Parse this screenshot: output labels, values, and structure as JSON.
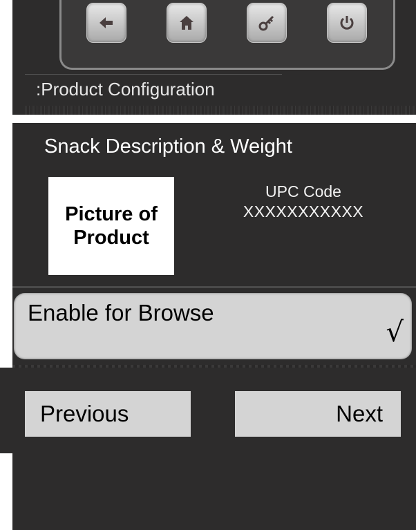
{
  "nav": {
    "back_icon": "back-arrow-icon",
    "home_icon": "home-icon",
    "key_icon": "key-icon",
    "power_icon": "power-icon"
  },
  "section": {
    "title": ":Product Configuration"
  },
  "product": {
    "heading": "Snack Description & Weight",
    "picture_placeholder": "Picture of Product",
    "upc_label": "UPC Code",
    "upc_value": "XXXXXXXXXXX"
  },
  "browse": {
    "label": "Enable for Browse",
    "check_glyph": "√",
    "enabled": true
  },
  "footer": {
    "previous_label": "Previous",
    "next_label": "Next"
  },
  "colors": {
    "screen_bg": "#2d2c2c",
    "button_bg": "#d4d4d4",
    "nav_button": "#c8c8c8"
  }
}
